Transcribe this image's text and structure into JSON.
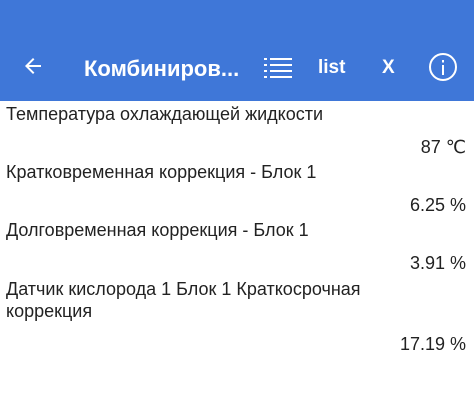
{
  "app_bar": {
    "title": "Комбиниров...",
    "list_label": "list",
    "close_label": "X",
    "icons": {
      "back": "arrow-back-icon",
      "list": "list-icon",
      "info": "info-icon"
    },
    "color": "#3f77d8"
  },
  "params": [
    {
      "name": "Температура охлаждающей жидкости",
      "value": "87 ℃"
    },
    {
      "name": "Кратковременная коррекция - Блок 1",
      "value": "6.25 %"
    },
    {
      "name": "Долговременная коррекция - Блок 1",
      "value": "3.91 %"
    },
    {
      "name": "Датчик кислорода 1 Блок 1 Краткосрочная коррекция",
      "value": "17.19 %"
    }
  ]
}
